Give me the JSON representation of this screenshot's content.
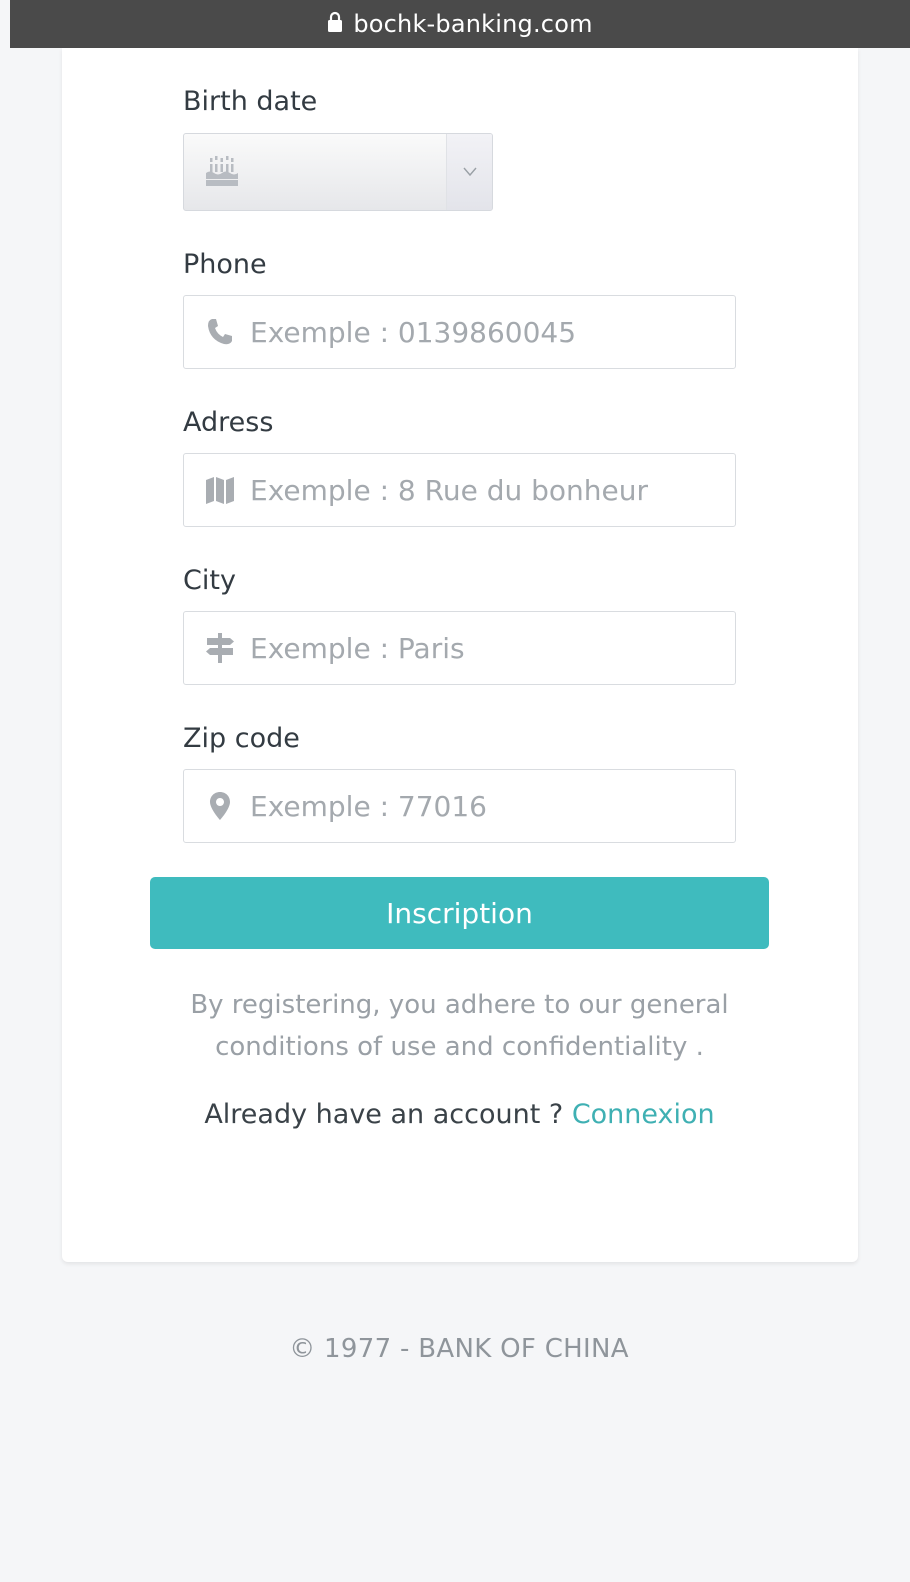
{
  "browser": {
    "url": "bochk-banking.com"
  },
  "form": {
    "birth_date": {
      "label": "Birth date"
    },
    "phone": {
      "label": "Phone",
      "placeholder": "Exemple : 0139860045"
    },
    "address": {
      "label": "Adress",
      "placeholder": "Exemple : 8 Rue du bonheur"
    },
    "city": {
      "label": "City",
      "placeholder": "Exemple : Paris"
    },
    "zip": {
      "label": "Zip code",
      "placeholder": "Exemple : 77016"
    },
    "submit_label": "Inscription",
    "terms_text": "By registering, you adhere to our general conditions of use and confidentiality .",
    "already_text": "Already have an account ?",
    "login_link": "Connexion"
  },
  "footer": {
    "copyright": "© 1977 - BANK OF CHINA"
  },
  "colors": {
    "accent": "#3fbbbe",
    "link": "#3fb0b3"
  },
  "icons": [
    "lock-icon",
    "birthday-cake-icon",
    "chevron-down-icon",
    "phone-icon",
    "map-icon",
    "signpost-icon",
    "map-marker-icon"
  ]
}
